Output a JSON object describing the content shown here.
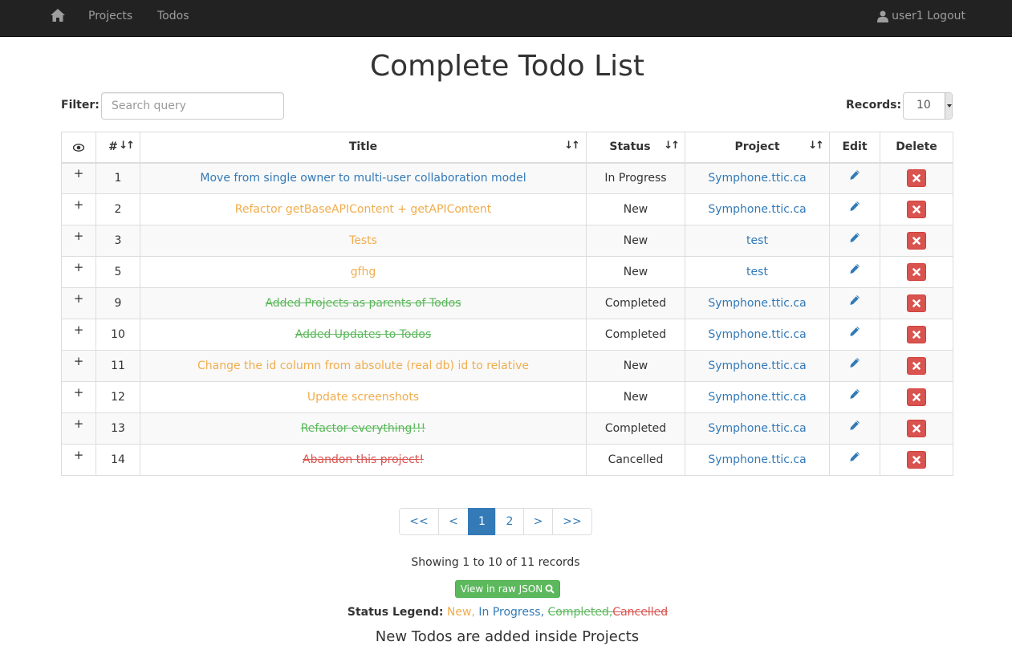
{
  "navbar": {
    "projects_label": "Projects",
    "todos_label": "Todos",
    "user_label": "user1 Logout",
    "home_icon": "home-icon",
    "user_icon": "user-icon"
  },
  "page_title": "Complete Todo List",
  "filter": {
    "label": "Filter:",
    "placeholder": "Search query",
    "value": ""
  },
  "records": {
    "label": "Records:",
    "value": "10"
  },
  "table": {
    "columns": [
      "",
      "#",
      "Title",
      "Status",
      "Project",
      "Edit",
      "Delete"
    ],
    "rows": [
      {
        "expand": "+",
        "num": "1",
        "title": "Move from single owner to multi-user collaboration model",
        "status": "In Progress",
        "status_class": "st-progress",
        "project": "Symphone.ttic.ca"
      },
      {
        "expand": "+",
        "num": "2",
        "title": "Refactor getBaseAPIContent + getAPIContent",
        "status": "New",
        "status_class": "st-new",
        "project": "Symphone.ttic.ca"
      },
      {
        "expand": "+",
        "num": "3",
        "title": "Tests",
        "status": "New",
        "status_class": "st-new",
        "project": "test"
      },
      {
        "expand": "+",
        "num": "5",
        "title": "gfhg",
        "status": "New",
        "status_class": "st-new",
        "project": "test"
      },
      {
        "expand": "+",
        "num": "9",
        "title": "Added Projects as parents of Todos",
        "status": "Completed",
        "status_class": "st-completed",
        "project": "Symphone.ttic.ca"
      },
      {
        "expand": "+",
        "num": "10",
        "title": "Added Updates to Todos",
        "status": "Completed",
        "status_class": "st-completed",
        "project": "Symphone.ttic.ca"
      },
      {
        "expand": "+",
        "num": "11",
        "title": "Change the id column from absolute (real db) id to relative",
        "status": "New",
        "status_class": "st-new",
        "project": "Symphone.ttic.ca"
      },
      {
        "expand": "+",
        "num": "12",
        "title": "Update screenshots",
        "status": "New",
        "status_class": "st-new",
        "project": "Symphone.ttic.ca"
      },
      {
        "expand": "+",
        "num": "13",
        "title": "Refactor everything!!!",
        "status": "Completed",
        "status_class": "st-completed",
        "project": "Symphone.ttic.ca"
      },
      {
        "expand": "+",
        "num": "14",
        "title": "Abandon this project!",
        "status": "Cancelled",
        "status_class": "st-cancelled",
        "project": "Symphone.ttic.ca"
      }
    ]
  },
  "pagination": {
    "first": "<<",
    "prev": "<",
    "pages": [
      "1",
      "2"
    ],
    "active": "1",
    "next": ">",
    "last": ">>"
  },
  "showing_text": "Showing 1 to 10 of 11 records",
  "json_button": "View in raw JSON",
  "legend": {
    "label": "Status Legend:",
    "new": "New,",
    "in_progress": "In Progress,",
    "completed": "Completed,",
    "cancelled": "Cancelled"
  },
  "footer_note": "New Todos are added inside Projects",
  "colors": {
    "new": "#f0ad4e",
    "in_progress": "#337ab7",
    "completed": "#5cb85c",
    "cancelled": "#d9534f",
    "navbar": "#222222"
  }
}
